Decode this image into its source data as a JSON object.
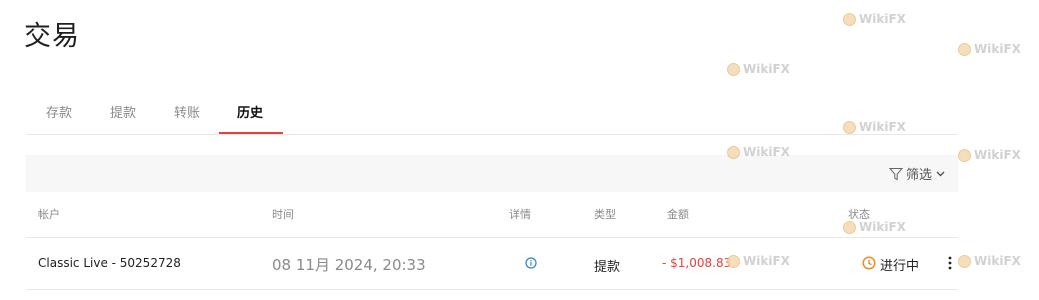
{
  "page": {
    "title": "交易"
  },
  "tabs": [
    {
      "label": "存款"
    },
    {
      "label": "提款"
    },
    {
      "label": "转账"
    },
    {
      "label": "历史"
    }
  ],
  "filter": {
    "label": "筛选"
  },
  "table": {
    "headers": {
      "account": "帐户",
      "time": "时间",
      "details": "详情",
      "type": "类型",
      "amount": "金额",
      "status": "状态"
    },
    "rows": [
      {
        "account": "Classic Live - 50252728",
        "time": "08 11月 2024, 20:33",
        "type": "提款",
        "amount": "- $1,008.83",
        "status": "进行中"
      }
    ]
  },
  "watermark": {
    "text": "WikiFX"
  },
  "colors": {
    "accent": "#e5403a",
    "status_pending": "#f08a24",
    "info": "#2f7fd8"
  }
}
